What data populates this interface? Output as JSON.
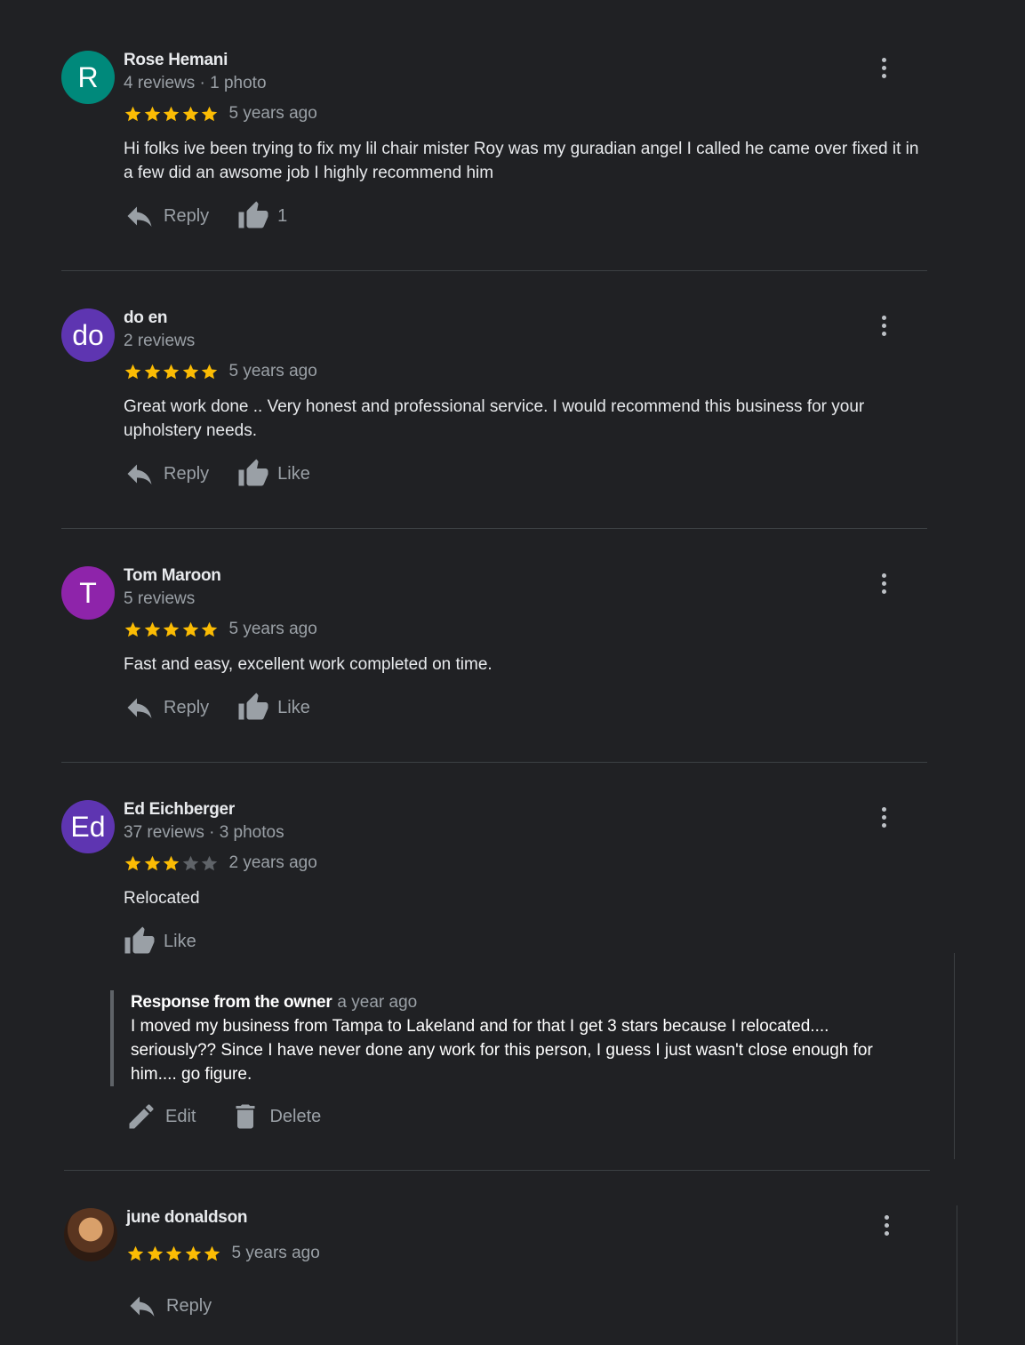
{
  "reviews": [
    {
      "avatar_letter": "R",
      "avatar_color": "#00897b",
      "name": "Rose Hemani",
      "meta": "4 reviews · 1 photo",
      "stars": 5,
      "when": "5 years ago",
      "text": "Hi folks ive been trying to fix my lil chair mister Roy was my guradian angel I called he came over fixed it in a few did an awsome job I highly recommend him",
      "reply_label": "Reply",
      "like_label": "1"
    },
    {
      "avatar_letter": "do",
      "avatar_color": "#5e35b1",
      "name": "do en",
      "meta": "2 reviews",
      "stars": 5,
      "when": "5 years ago",
      "text": "Great work done .. Very honest and professional service. I would recommend this business for your upholstery needs.",
      "reply_label": "Reply",
      "like_label": "Like"
    },
    {
      "avatar_letter": "T",
      "avatar_color": "#8e24aa",
      "name": "Tom Maroon",
      "meta": "5 reviews",
      "stars": 5,
      "when": "5 years ago",
      "text": "Fast and easy, excellent work completed on time.",
      "reply_label": "Reply",
      "like_label": "Like"
    },
    {
      "avatar_letter": "Ed",
      "avatar_color": "#5e35b1",
      "name": "Ed Eichberger",
      "meta": "37 reviews · 3 photos",
      "stars": 3,
      "when": "2 years ago",
      "text": "Relocated",
      "like_label": "Like",
      "owner_response": {
        "title": "Response from the owner",
        "when": "a year ago",
        "text": "I moved my business from Tampa to Lakeland and for that I get 3 stars because I relocated.... seriously?? Since I have never done any work for this person, I guess I just wasn't close enough for him.... go figure.",
        "edit_label": "Edit",
        "delete_label": "Delete"
      }
    },
    {
      "name": "june donaldson",
      "stars": 5,
      "when": "5 years ago",
      "reply_label": "Reply"
    }
  ],
  "colors": {
    "background": "#202124",
    "star_filled": "#fbbc04",
    "star_empty": "#5f6368",
    "muted_text": "#9aa0a6",
    "divider": "#3c4043"
  },
  "icons": {
    "reply": "reply-arrow-icon",
    "like": "thumbs-up-icon",
    "menu": "more-vert-icon",
    "edit": "pencil-icon",
    "delete": "trash-icon",
    "star": "star-icon"
  }
}
